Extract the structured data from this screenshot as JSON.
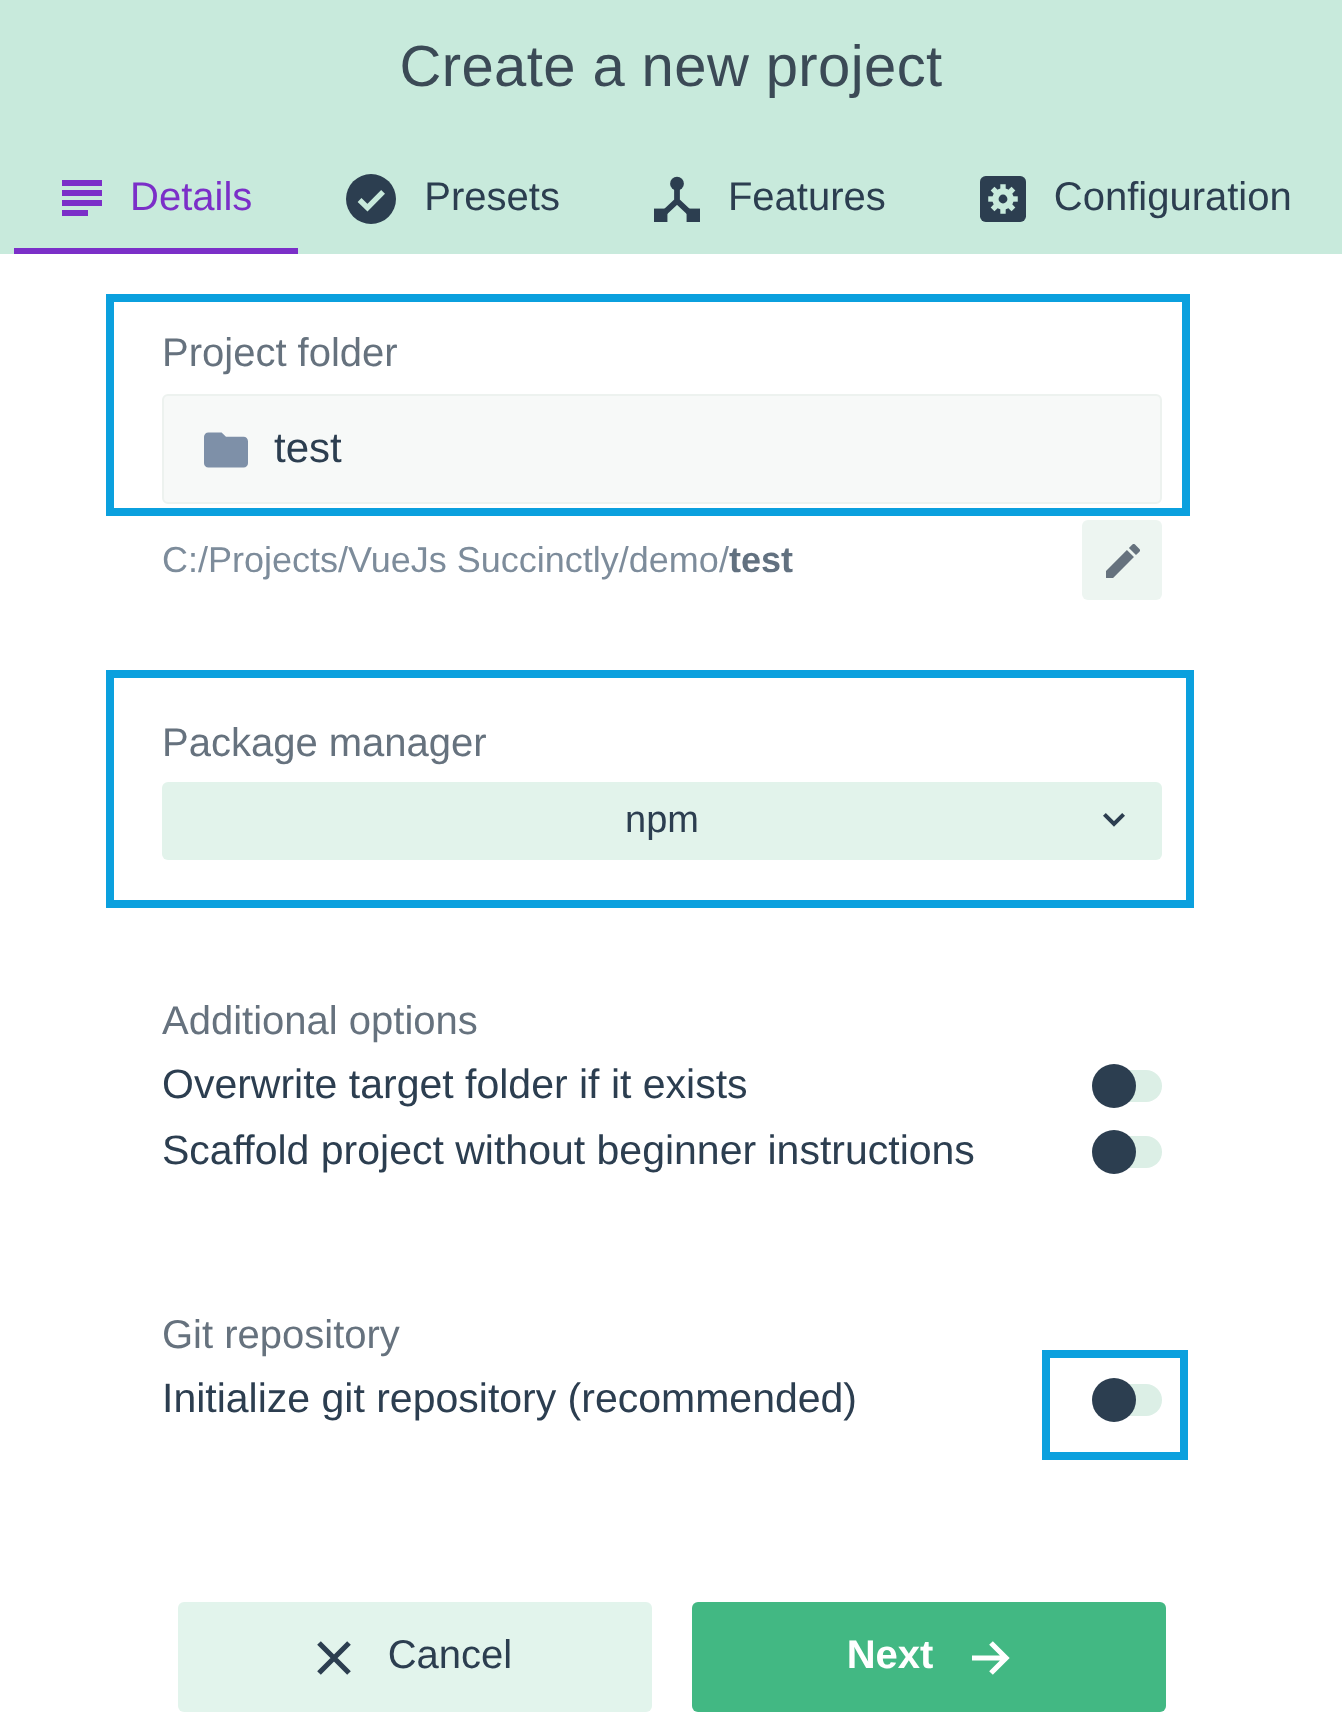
{
  "window": {
    "title": "Create a new project"
  },
  "tabs": [
    {
      "label": "Details",
      "selected": true
    },
    {
      "label": "Presets",
      "selected": false
    },
    {
      "label": "Features",
      "selected": false
    },
    {
      "label": "Configuration",
      "selected": false
    }
  ],
  "project_folder": {
    "label": "Project folder",
    "value": "test",
    "path": "C:/Projects/VueJs Succinctly/demo/**test**",
    "highlighted": true
  },
  "package_manager": {
    "label": "Package manager",
    "value": "npm",
    "highlighted": true
  },
  "option_groups": [
    {
      "heading": "Additional options",
      "options": [
        {
          "label": "Overwrite target folder if it exists",
          "on": false,
          "highlighted": false
        },
        {
          "label": "Scaffold project without beginner instructions",
          "on": false,
          "highlighted": false
        }
      ]
    },
    {
      "heading": "Git repository",
      "options": [
        {
          "label": "Initialize git repository (recommended)",
          "on": false,
          "highlighted": true
        }
      ]
    }
  ],
  "buttons": [
    {
      "label": "Cancel",
      "kind": "secondary"
    },
    {
      "label": "Next",
      "kind": "primary"
    }
  ]
}
